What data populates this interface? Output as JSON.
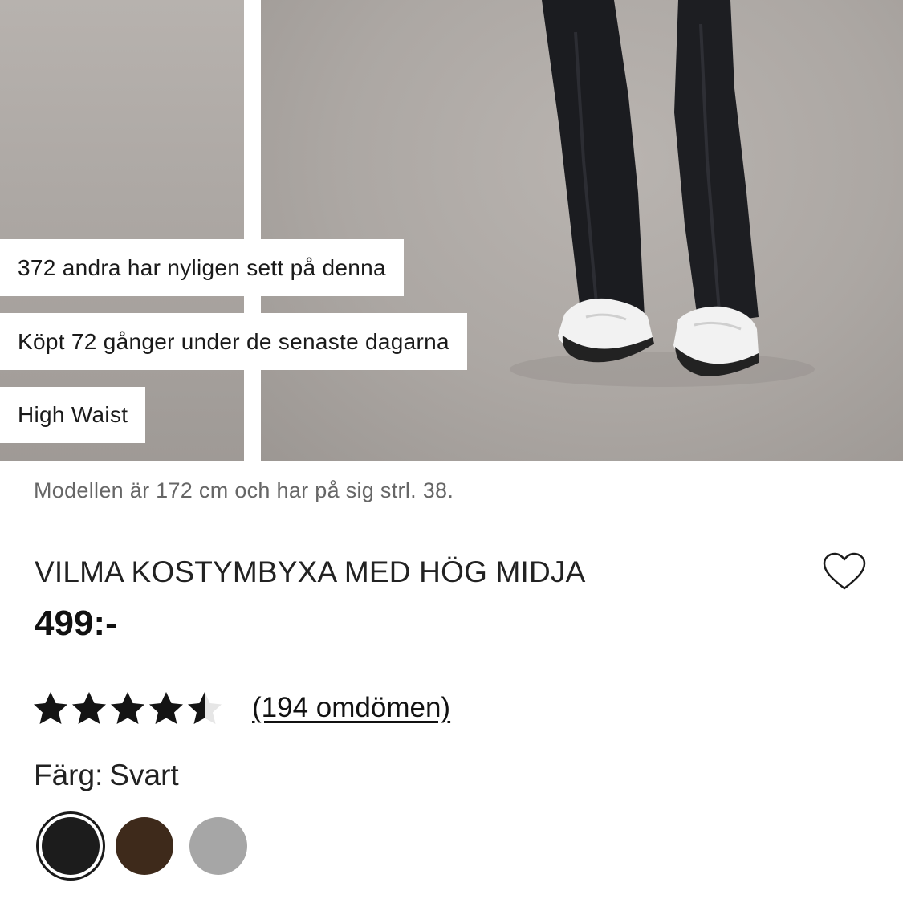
{
  "hero": {
    "badges": [
      "372 andra har nyligen sett på denna",
      "Köpt 72 gånger under de senaste dagarna",
      "High Waist"
    ]
  },
  "product": {
    "model_note": "Modellen är 172 cm och har på sig strl. 38.",
    "title": "VILMA KOSTYMBYXA MED HÖG MIDJA",
    "price": "499:-",
    "rating": 4.5,
    "reviews_label": "(194 omdömen)",
    "wishlist_icon": "heart-outline-icon"
  },
  "color": {
    "label": "Färg:",
    "selected": "Svart",
    "swatches": [
      "#1c1c1c",
      "#3e2a1b",
      "#a6a6a6"
    ]
  }
}
